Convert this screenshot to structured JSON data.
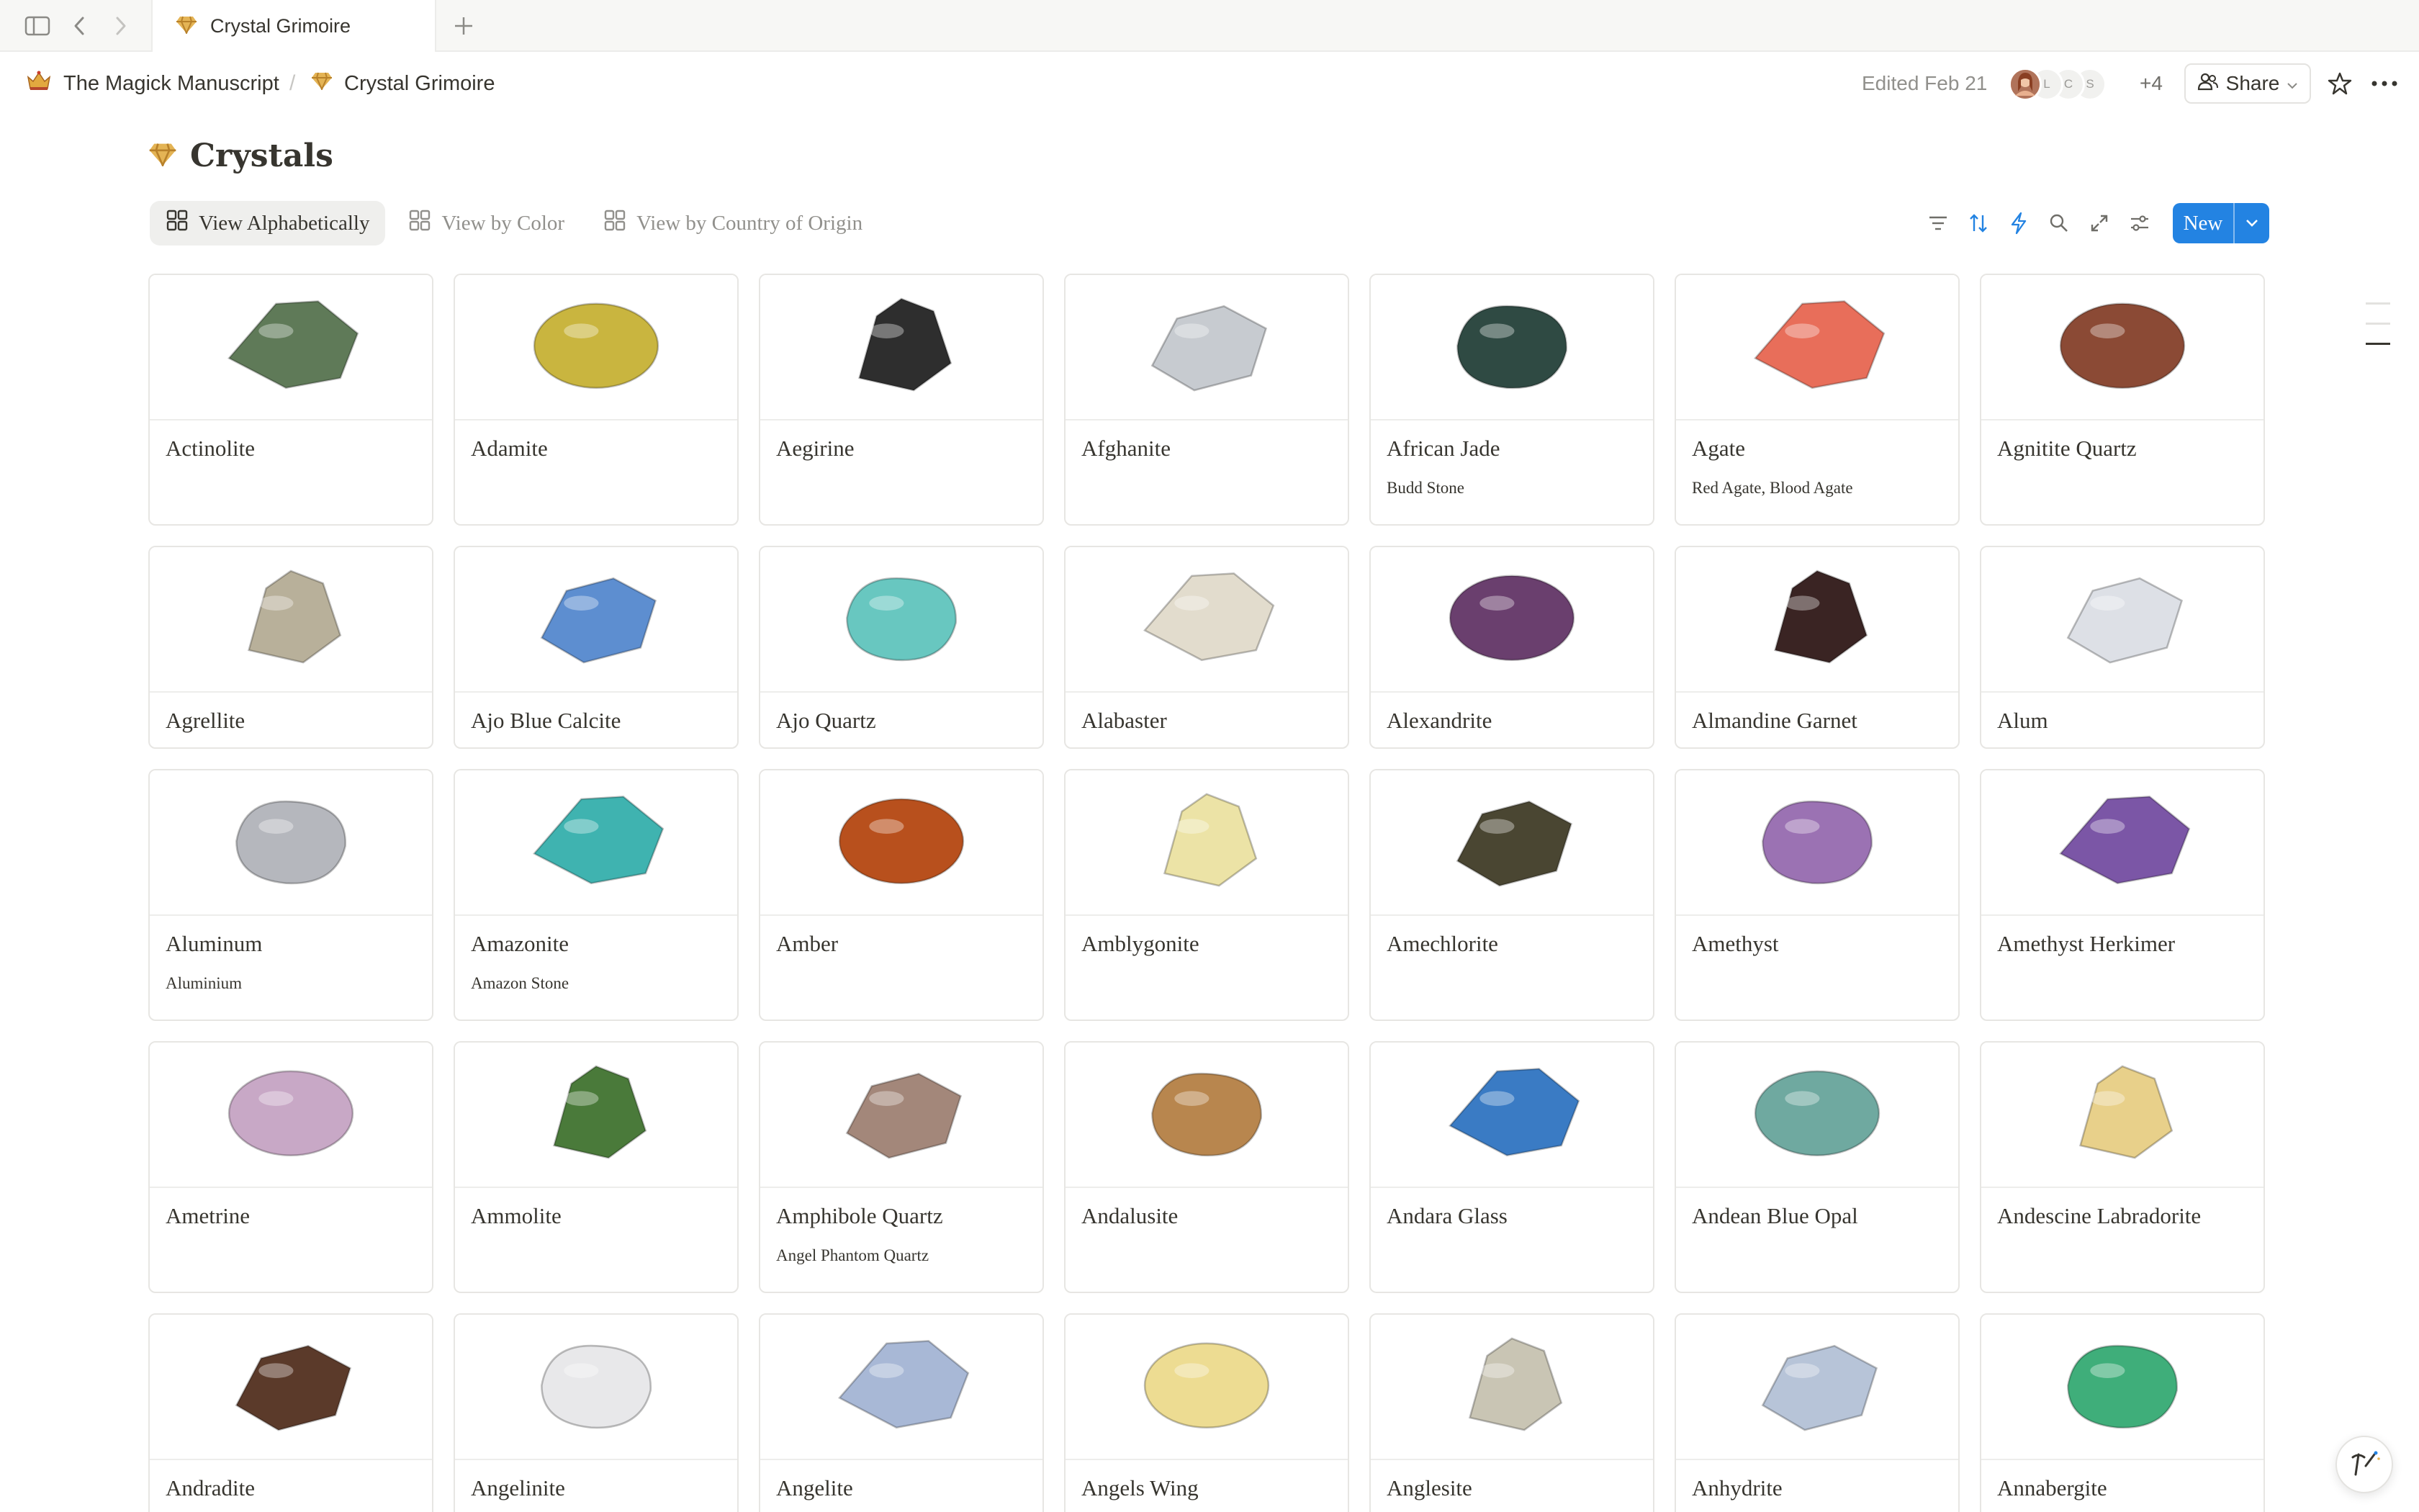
{
  "browser": {
    "tab_title": "Crystal Grimoire"
  },
  "breadcrumb": {
    "workspace": "The Magick Manuscript",
    "page": "Crystal Grimoire"
  },
  "header": {
    "edited": "Edited Feb 21",
    "avatar_initials": [
      "L",
      "C",
      "S"
    ],
    "more_collaborators": "+4",
    "share_label": "Share"
  },
  "page_title": "Crystals",
  "views": [
    {
      "label": "View Alphabetically",
      "active": true
    },
    {
      "label": "View by Color",
      "active": false
    },
    {
      "label": "View by Country of Origin",
      "active": false
    }
  ],
  "toolbar": {
    "new_label": "New",
    "icons": [
      "filter-icon",
      "sort-icon",
      "automation-icon",
      "search-icon",
      "expand-icon",
      "settings-icon"
    ]
  },
  "colors": {
    "accent": "#2383e2",
    "gem_icon": "#d9a441",
    "text": "#37352f",
    "muted": "#91908c"
  },
  "cards": [
    {
      "name": "Actinolite",
      "alias": "",
      "color": "#5f7a58"
    },
    {
      "name": "Adamite",
      "alias": "",
      "color": "#c9b53f"
    },
    {
      "name": "Aegirine",
      "alias": "",
      "color": "#2e2e2e"
    },
    {
      "name": "Afghanite",
      "alias": "",
      "color": "#c7cbd0"
    },
    {
      "name": "African Jade",
      "alias": "Budd Stone",
      "color": "#2f4a43"
    },
    {
      "name": "Agate",
      "alias": "Red Agate, Blood Agate",
      "color": "#e86e5a"
    },
    {
      "name": "Agnitite Quartz",
      "alias": "",
      "color": "#8b4a35"
    },
    {
      "name": "Agrellite",
      "alias": "",
      "color": "#b8b09a"
    },
    {
      "name": "Ajo Blue Calcite",
      "alias": "",
      "color": "#5d8ed0"
    },
    {
      "name": "Ajo Quartz",
      "alias": "",
      "color": "#68c7c0"
    },
    {
      "name": "Alabaster",
      "alias": "",
      "color": "#e2dccd"
    },
    {
      "name": "Alexandrite",
      "alias": "",
      "color": "#6a3f6e"
    },
    {
      "name": "Almandine Garnet",
      "alias": "",
      "color": "#3a2423"
    },
    {
      "name": "Alum",
      "alias": "",
      "color": "#dde0e6"
    },
    {
      "name": "Aluminum",
      "alias": "Aluminium",
      "color": "#b5b7bd"
    },
    {
      "name": "Amazonite",
      "alias": "Amazon Stone",
      "color": "#3fb3b0"
    },
    {
      "name": "Amber",
      "alias": "",
      "color": "#b8501d"
    },
    {
      "name": "Amblygonite",
      "alias": "",
      "color": "#ece3a6"
    },
    {
      "name": "Amechlorite",
      "alias": "",
      "color": "#4a4632"
    },
    {
      "name": "Amethyst",
      "alias": "",
      "color": "#9b72b3"
    },
    {
      "name": "Amethyst Herkimer",
      "alias": "",
      "color": "#7b56a6"
    },
    {
      "name": "Ametrine",
      "alias": "",
      "color": "#c8a8c6"
    },
    {
      "name": "Ammolite",
      "alias": "",
      "color": "#4a7a3a"
    },
    {
      "name": "Amphibole Quartz",
      "alias": "Angel Phantom Quartz",
      "color": "#a3877a"
    },
    {
      "name": "Andalusite",
      "alias": "",
      "color": "#b8864e"
    },
    {
      "name": "Andara Glass",
      "alias": "",
      "color": "#3a7bc4"
    },
    {
      "name": "Andean Blue Opal",
      "alias": "",
      "color": "#6fa9a0"
    },
    {
      "name": "Andescine Labradorite",
      "alias": "",
      "color": "#e8d08a"
    },
    {
      "name": "Andradite",
      "alias": "",
      "color": "#5b3a2a"
    },
    {
      "name": "Angelinite",
      "alias": "",
      "color": "#e8e8ea"
    },
    {
      "name": "Angelite",
      "alias": "",
      "color": "#a8b8d6"
    },
    {
      "name": "Angels Wing",
      "alias": "",
      "color": "#eddc92"
    },
    {
      "name": "Anglesite",
      "alias": "",
      "color": "#c9c5b4"
    },
    {
      "name": "Anhydrite",
      "alias": "",
      "color": "#b7c4d8"
    },
    {
      "name": "Annabergite",
      "alias": "",
      "color": "#3fae7a"
    }
  ]
}
